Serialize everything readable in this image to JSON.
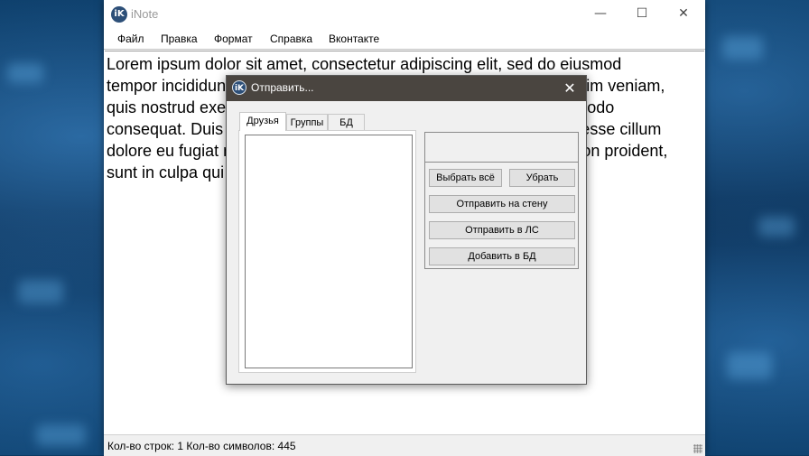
{
  "window": {
    "title": "iNote",
    "icon_glyph": "iK",
    "controls": {
      "minimize": "—",
      "maximize": "☐",
      "close": "✕"
    }
  },
  "menu": [
    "Файл",
    "Правка",
    "Формат",
    "Справка",
    "Вконтакте"
  ],
  "editor": {
    "lines": [
      "Lorem ipsum dolor sit amet, consectetur adipiscing elit, sed do eiusmod",
      "tempor incididunt ut labore et dolore magna aliqua. Ut enim ad minim veniam,",
      "quis nostrud exercitation ullamco laboris nisi ut aliquip ex ea commodo",
      "consequat. Duis aute irure dolor in reprehenderit in voluptate velit esse cillum",
      "dolore eu fugiat nulla pariatur. Excepteur sint occaecat cupidatat non proident,",
      "sunt in culpa qui officia deserunt mollit anim id est laborum."
    ]
  },
  "status": {
    "text": "Кол-во строк: 1  Кол-во символов: 445"
  },
  "dialog": {
    "title": "Отправить...",
    "icon_glyph": "iK",
    "close": "✕",
    "tabs": [
      "Друзья",
      "Группы",
      "БД"
    ],
    "active_tab": "Друзья",
    "textbox_value": "",
    "buttons": {
      "select_all": "Выбрать всё",
      "remove": "Убрать",
      "post_wall": "Отправить на стену",
      "send_pm": "Отправить в ЛС",
      "add_db": "Добавить в БД"
    }
  }
}
